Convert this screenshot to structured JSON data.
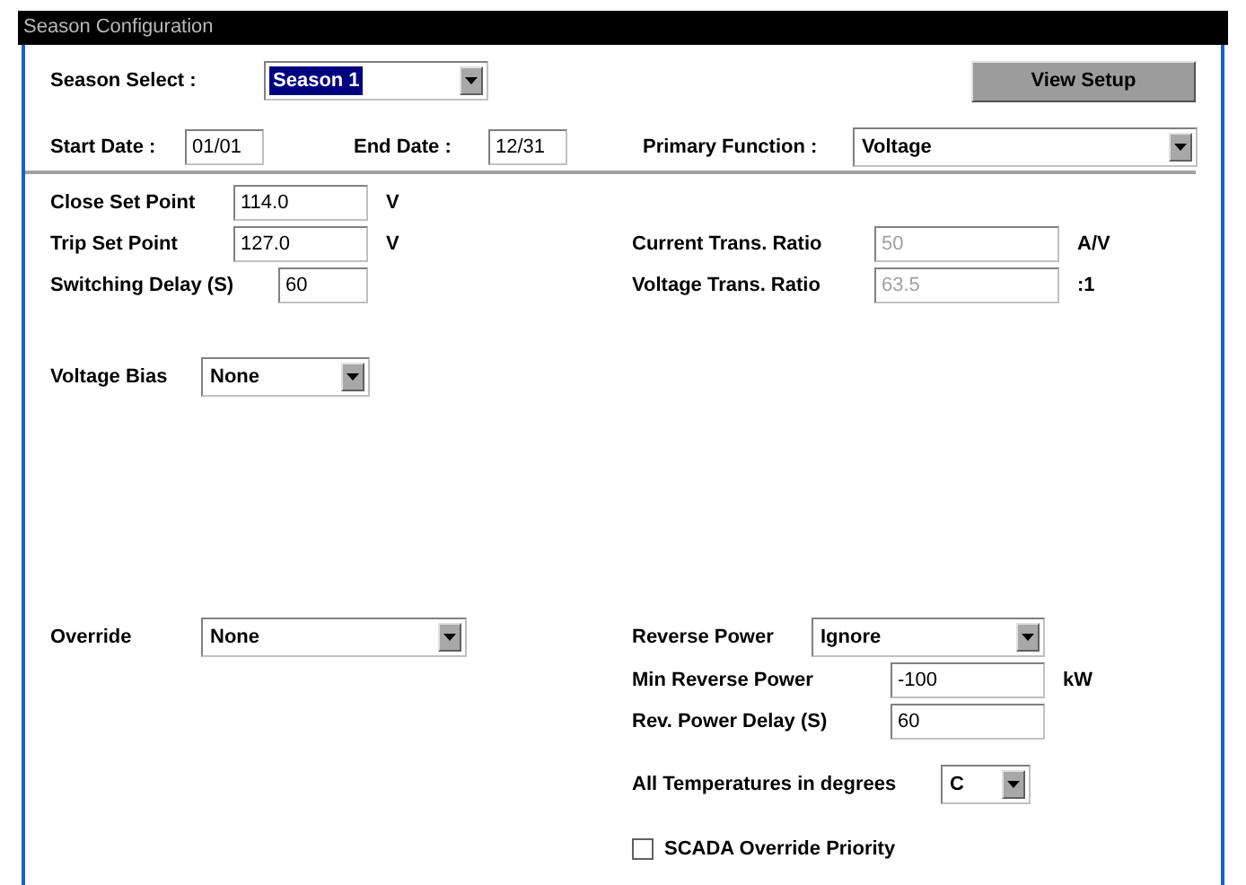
{
  "window": {
    "title": "Season Configuration"
  },
  "season_select": {
    "label": "Season Select :",
    "value": "Season 1",
    "highlighted": true
  },
  "view_setup_button": "View Setup",
  "start_date": {
    "label": "Start Date :",
    "value": "01/01",
    "disabled": false
  },
  "end_date": {
    "label": "End Date :",
    "value": "12/31",
    "disabled": false
  },
  "primary_function": {
    "label": "Primary Function :",
    "value": "Voltage",
    "highlighted": false
  },
  "close_set_point": {
    "label": "Close Set Point",
    "value": "114.0",
    "unit": "V",
    "disabled": false
  },
  "trip_set_point": {
    "label": "Trip Set Point",
    "value": "127.0",
    "unit": "V",
    "disabled": false
  },
  "switching_delay": {
    "label": "Switching Delay (S)",
    "value": "60",
    "disabled": false
  },
  "current_trans_ratio": {
    "label": "Current Trans. Ratio",
    "value": "50",
    "unit": "A/V",
    "disabled": true
  },
  "voltage_trans_ratio": {
    "label": "Voltage Trans. Ratio",
    "value": "63.5",
    "unit": ":1",
    "disabled": true
  },
  "voltage_bias": {
    "label": "Voltage Bias",
    "value": "None",
    "highlighted": false
  },
  "override": {
    "label": "Override",
    "value": "None",
    "highlighted": false
  },
  "reverse_power": {
    "label": "Reverse Power",
    "value": "Ignore",
    "highlighted": false
  },
  "min_reverse_power": {
    "label": "Min Reverse Power",
    "value": "-100",
    "unit": "kW",
    "disabled": false
  },
  "rev_power_delay": {
    "label": "Rev. Power Delay (S)",
    "value": "60",
    "disabled": false
  },
  "temperature_units": {
    "label": "All Temperatures in degrees",
    "value": "C",
    "highlighted": false
  },
  "scada_override_priority": {
    "label": "SCADA Override Priority",
    "checked": false
  }
}
